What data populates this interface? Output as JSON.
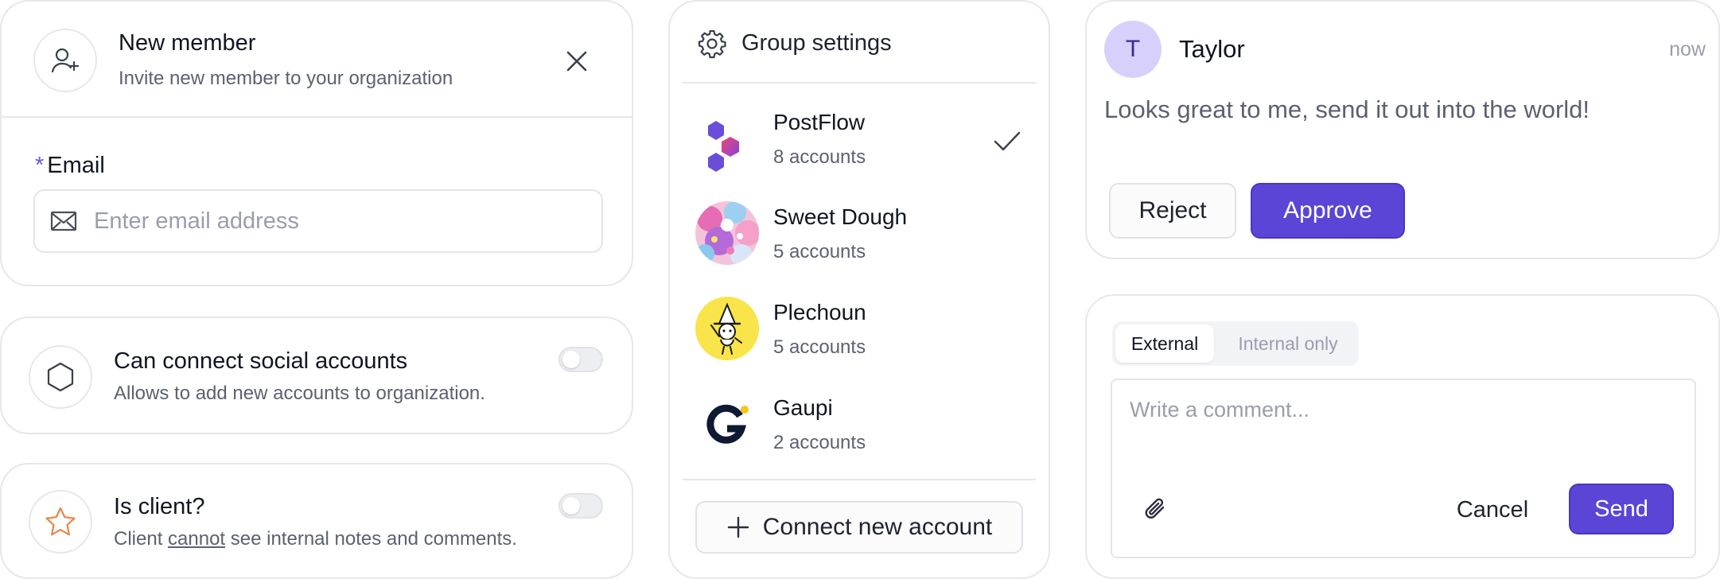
{
  "new_member": {
    "title": "New member",
    "subtitle": "Invite new member to your organization",
    "email_label": "Email",
    "required_mark": "*",
    "email_placeholder": "Enter email address"
  },
  "permissions": {
    "social": {
      "title": "Can connect social accounts",
      "description": "Allows to add new accounts to organization."
    },
    "client": {
      "title": "Is client?",
      "description_before": "Client ",
      "description_emphasis": "cannot",
      "description_after": " see internal notes and comments."
    }
  },
  "group_settings": {
    "title": "Group settings",
    "accounts": [
      {
        "name": "PostFlow",
        "count": "8 accounts",
        "selected": true
      },
      {
        "name": "Sweet Dough",
        "count": "5 accounts",
        "selected": false
      },
      {
        "name": "Plechoun",
        "count": "5 accounts",
        "selected": false
      },
      {
        "name": "Gaupi",
        "count": "2 accounts",
        "selected": false
      }
    ],
    "connect_label": "Connect new account"
  },
  "approval": {
    "avatar_initial": "T",
    "author": "Taylor",
    "time": "now",
    "message": "Looks great to me, send it out into the world!",
    "reject_label": "Reject",
    "approve_label": "Approve"
  },
  "comment": {
    "tabs": [
      "External",
      "Internal only"
    ],
    "active_tab": "External",
    "placeholder": "Write a comment...",
    "cancel_label": "Cancel",
    "send_label": "Send"
  },
  "colors": {
    "accent": "#5b45d6",
    "accent_border": "#4a36c0",
    "avatar_bg": "#d7d0fb",
    "star": "#e8854a",
    "required": "#6b55e0"
  }
}
